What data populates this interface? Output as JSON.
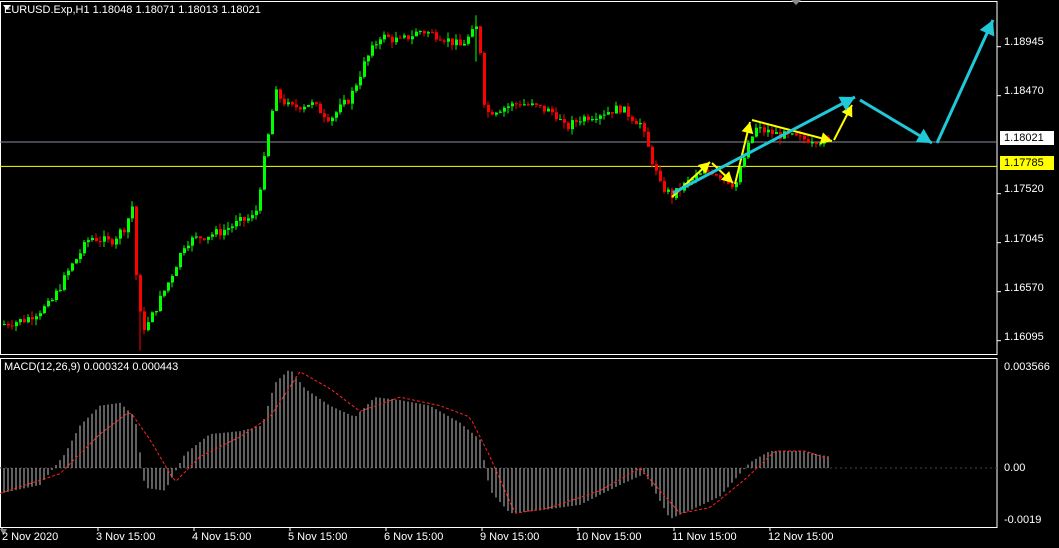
{
  "window": {
    "symbol_line": "EURUSD.Exp,H1  1.18048 1.18071 1.18013 1.18021"
  },
  "price_axis": {
    "ticks": [
      "1.18945",
      "1.18470",
      "1.17520",
      "1.17045",
      "1.16570",
      "1.16095"
    ],
    "current_price": "1.18021",
    "level_price": "1.17785"
  },
  "macd": {
    "title": "MACD(12,26,9) 0.000324 0.000443",
    "ticks": [
      "0.003566",
      "0.00",
      "-0.0019"
    ]
  },
  "time_axis": {
    "labels": [
      "2 Nov 2020",
      "3 Nov 15:00",
      "4 Nov 15:00",
      "5 Nov 15:00",
      "6 Nov 15:00",
      "9 Nov 15:00",
      "10 Nov 15:00",
      "11 Nov 15:00",
      "12 Nov 15:00"
    ]
  },
  "colors": {
    "background": "#000000",
    "bull": "#00ff00",
    "bear": "#ff0000",
    "level_line": "#ffff00",
    "current_line": "#8c8c9c",
    "arrow_yellow": "#ffff00",
    "arrow_cyan": "#20c8d8",
    "macd_hist": "#c0c0c0",
    "macd_signal": "#ff2020"
  },
  "chart_data": {
    "type": "candlestick",
    "symbol": "EURUSD.Exp",
    "timeframe": "H1",
    "close_path": [
      [
        0,
        1.1625
      ],
      [
        25,
        1.163
      ],
      [
        50,
        1.1645
      ],
      [
        70,
        1.168
      ],
      [
        90,
        1.171
      ],
      [
        110,
        1.1705
      ],
      [
        125,
        1.172
      ],
      [
        132,
        1.174
      ],
      [
        138,
        1.164
      ],
      [
        145,
        1.162
      ],
      [
        155,
        1.164
      ],
      [
        170,
        1.167
      ],
      [
        185,
        1.1705
      ],
      [
        200,
        1.171
      ],
      [
        220,
        1.1715
      ],
      [
        240,
        1.1725
      ],
      [
        255,
        1.173
      ],
      [
        265,
        1.179
      ],
      [
        275,
        1.185
      ],
      [
        290,
        1.1835
      ],
      [
        310,
        1.184
      ],
      [
        330,
        1.1825
      ],
      [
        350,
        1.1845
      ],
      [
        365,
        1.188
      ],
      [
        380,
        1.1905
      ],
      [
        400,
        1.19
      ],
      [
        420,
        1.191
      ],
      [
        440,
        1.1905
      ],
      [
        460,
        1.1895
      ],
      [
        470,
        1.1905
      ],
      [
        478,
        1.1915
      ],
      [
        485,
        1.183
      ],
      [
        500,
        1.1835
      ],
      [
        520,
        1.184
      ],
      [
        540,
        1.1835
      ],
      [
        555,
        1.183
      ],
      [
        565,
        1.1815
      ],
      [
        580,
        1.1825
      ],
      [
        600,
        1.183
      ],
      [
        620,
        1.1835
      ],
      [
        640,
        1.182
      ],
      [
        650,
        1.179
      ],
      [
        660,
        1.176
      ],
      [
        672,
        1.175
      ],
      [
        690,
        1.1765
      ],
      [
        710,
        1.1775
      ],
      [
        720,
        1.177
      ],
      [
        735,
        1.176
      ],
      [
        745,
        1.179
      ],
      [
        755,
        1.1815
      ],
      [
        775,
        1.181
      ],
      [
        800,
        1.1805
      ],
      [
        815,
        1.1805
      ],
      [
        830,
        1.1802
      ]
    ],
    "macd_hist_path": [
      [
        0,
        -0.0009
      ],
      [
        40,
        -0.0006
      ],
      [
        65,
        0.0005
      ],
      [
        80,
        0.0015
      ],
      [
        100,
        0.0022
      ],
      [
        120,
        0.0023
      ],
      [
        135,
        0.0018
      ],
      [
        145,
        -0.0007
      ],
      [
        165,
        -0.0008
      ],
      [
        185,
        0.0005
      ],
      [
        210,
        0.0012
      ],
      [
        240,
        0.0013
      ],
      [
        262,
        0.0015
      ],
      [
        275,
        0.003
      ],
      [
        290,
        0.0035
      ],
      [
        305,
        0.0028
      ],
      [
        330,
        0.0022
      ],
      [
        355,
        0.0018
      ],
      [
        375,
        0.0025
      ],
      [
        400,
        0.0024
      ],
      [
        430,
        0.0022
      ],
      [
        460,
        0.0016
      ],
      [
        480,
        0.001
      ],
      [
        490,
        -0.0008
      ],
      [
        510,
        -0.0016
      ],
      [
        540,
        -0.0015
      ],
      [
        580,
        -0.0013
      ],
      [
        620,
        -0.0006
      ],
      [
        645,
        -0.0002
      ],
      [
        670,
        -0.0018
      ],
      [
        690,
        -0.0015
      ],
      [
        720,
        -0.001
      ],
      [
        750,
        0.0002
      ],
      [
        770,
        0.0006
      ],
      [
        800,
        0.0006
      ],
      [
        830,
        0.0004
      ]
    ],
    "macd_signal_path": [
      [
        0,
        -0.0009
      ],
      [
        60,
        -0.0002
      ],
      [
        100,
        0.0012
      ],
      [
        130,
        0.002
      ],
      [
        150,
        0.001
      ],
      [
        175,
        -0.0005
      ],
      [
        200,
        0.0004
      ],
      [
        240,
        0.0011
      ],
      [
        270,
        0.0018
      ],
      [
        300,
        0.0034
      ],
      [
        330,
        0.0028
      ],
      [
        360,
        0.002
      ],
      [
        400,
        0.0025
      ],
      [
        440,
        0.0022
      ],
      [
        470,
        0.0018
      ],
      [
        490,
        0.0004
      ],
      [
        515,
        -0.0016
      ],
      [
        550,
        -0.0014
      ],
      [
        600,
        -0.0008
      ],
      [
        640,
        0.0
      ],
      [
        680,
        -0.0016
      ],
      [
        710,
        -0.0014
      ],
      [
        745,
        -0.0004
      ],
      [
        775,
        0.0006
      ],
      [
        805,
        0.0006
      ],
      [
        830,
        0.0003
      ]
    ]
  }
}
